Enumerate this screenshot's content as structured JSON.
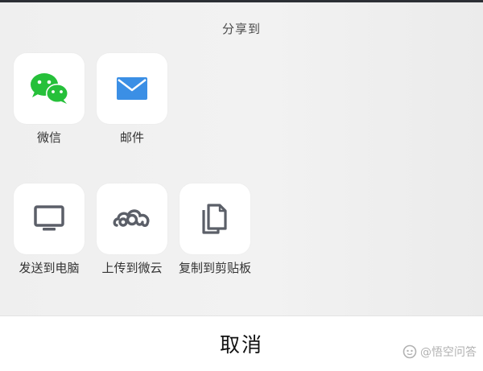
{
  "share_sheet": {
    "title": "分享到",
    "row1": [
      {
        "label": "微信",
        "icon": "wechat-icon",
        "color": "#26c03a"
      },
      {
        "label": "邮件",
        "icon": "mail-icon",
        "color": "#3b8fe5"
      }
    ],
    "row2": [
      {
        "label": "发送到电脑",
        "icon": "computer-icon",
        "color": "#5b5f68"
      },
      {
        "label": "上传到微云",
        "icon": "cloud-icon",
        "color": "#5b5f68"
      },
      {
        "label": "复制到剪贴板",
        "icon": "clipboard-copy-icon",
        "color": "#5b5f68"
      }
    ]
  },
  "cancel_label": "取消",
  "watermark": {
    "text": "@悟空问答",
    "icon": "wukong-icon"
  }
}
